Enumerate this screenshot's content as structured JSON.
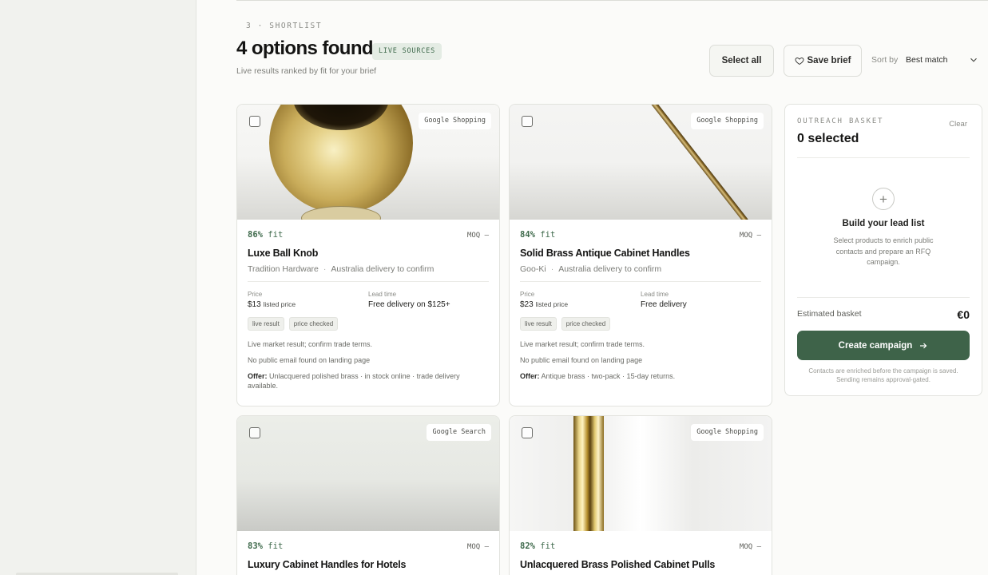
{
  "header": {
    "step": "3 · SHORTLIST",
    "title": "4 options found",
    "badge": "LIVE SOURCES",
    "subtitle": "Live results ranked by fit for your brief"
  },
  "toolbar": {
    "select_all": "Select all",
    "save_brief": "Save brief",
    "sort_label": "Sort by",
    "sort_value": "Best match"
  },
  "products": [
    {
      "source": "Google Shopping",
      "fit_pct": "86%",
      "fit_word": "fit",
      "moq": "MOQ —",
      "name": "Luxe Ball Knob",
      "vendor": "Tradition Hardware",
      "delivery": "Australia delivery to confirm",
      "price_label": "Price",
      "price": "$13",
      "price_note": "listed price",
      "lead_label": "Lead time",
      "lead": "Free delivery on $125+",
      "chips": [
        "live result",
        "price checked"
      ],
      "note1": "Live market result; confirm trade terms.",
      "note2": "No public email found on landing page",
      "offer_label": "Offer:",
      "offer": "Unlacquered polished brass · in stock online · trade delivery available."
    },
    {
      "source": "Google Shopping",
      "fit_pct": "84%",
      "fit_word": "fit",
      "moq": "MOQ —",
      "name": "Solid Brass Antique Cabinet Handles",
      "vendor": "Goo-Ki",
      "delivery": "Australia delivery to confirm",
      "price_label": "Price",
      "price": "$23",
      "price_note": "listed price",
      "lead_label": "Lead time",
      "lead": "Free delivery",
      "chips": [
        "live result",
        "price checked"
      ],
      "note1": "Live market result; confirm trade terms.",
      "note2": "No public email found on landing page",
      "offer_label": "Offer:",
      "offer": "Antique brass · two-pack · 15-day returns."
    },
    {
      "source": "Google Search",
      "fit_pct": "83%",
      "fit_word": "fit",
      "moq": "MOQ —",
      "name": "Luxury Cabinet Handles for Hotels"
    },
    {
      "source": "Google Shopping",
      "fit_pct": "82%",
      "fit_word": "fit",
      "moq": "MOQ —",
      "name": "Unlacquered Brass Polished Cabinet Pulls"
    }
  ],
  "basket": {
    "label": "OUTREACH BASKET",
    "clear": "Clear",
    "count": "0 selected",
    "empty_title": "Build your lead list",
    "empty_desc": "Select products to enrich public contacts and prepare an RFQ campaign.",
    "estimate_label": "Estimated basket",
    "estimate_value": "€0",
    "cta": "Create campaign",
    "fine_print": "Contacts are enriched before the campaign is saved. Sending remains approval-gated."
  },
  "colors": {
    "accent": "#3e6349",
    "fit_text": "#3f6a4c",
    "badge_bg": "#e4ece4"
  },
  "icons": {
    "save": "heart-icon",
    "sort": "chevron-down-icon",
    "cta": "arrow-right-icon",
    "empty": "plus-icon"
  }
}
